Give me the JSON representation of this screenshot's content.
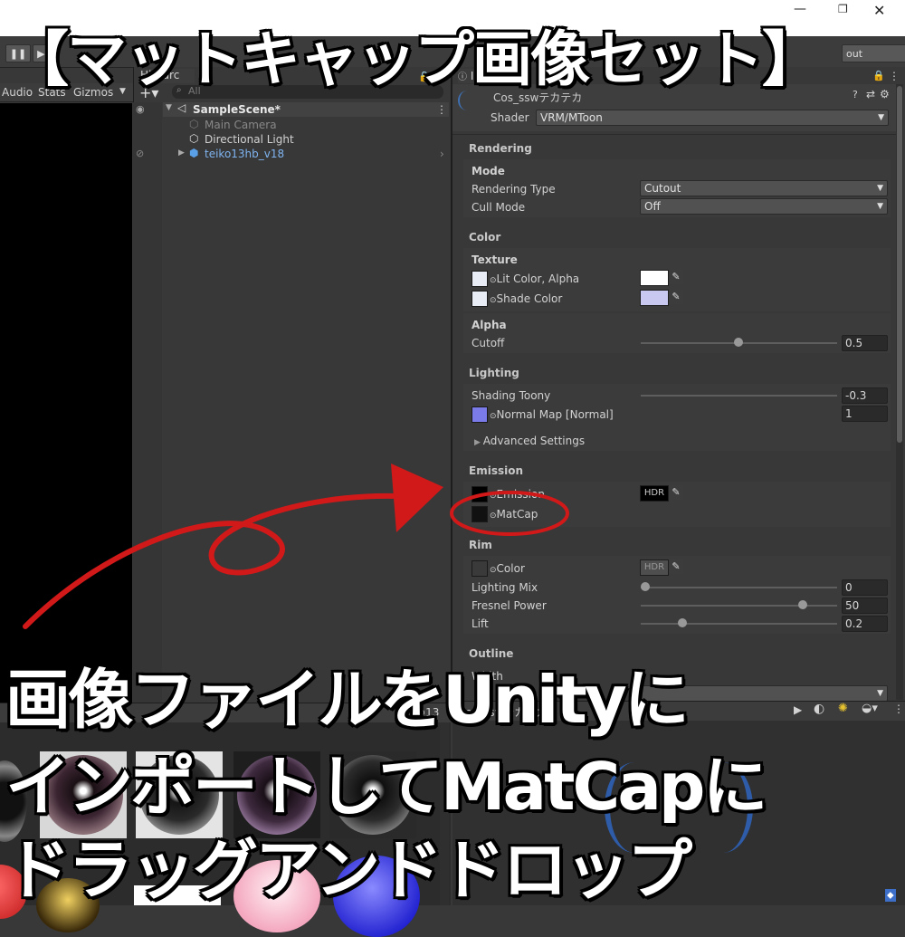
{
  "banner": "【マットキャップ画像セット】",
  "overlay": {
    "line1": "画像ファイルをUnityに",
    "line2": "インポートしてMatCapに",
    "line3": "ドラッグアンドドロップ"
  },
  "game_toolbar": {
    "audio": "Audio",
    "stats": "Stats",
    "gizmos": "Gizmos"
  },
  "top_toolbar": {
    "layout": "out"
  },
  "hierarchy": {
    "tab": "Hierarc",
    "search_placeholder": "All",
    "items": [
      {
        "label": "SampleScene*"
      },
      {
        "label": "Main Camera"
      },
      {
        "label": "Directional Light"
      },
      {
        "label": "teiko13hb_v18"
      }
    ]
  },
  "inspector": {
    "tab": "Ins",
    "material_name": "Cos_sswテカテカ",
    "shader_label": "Shader",
    "shader_value": "VRM/MToon",
    "sections": {
      "rendering": "Rendering",
      "mode": "Mode",
      "rendering_type_label": "Rendering Type",
      "rendering_type_value": "Cutout",
      "cull_mode_label": "Cull Mode",
      "cull_mode_value": "Off",
      "color": "Color",
      "texture": "Texture",
      "lit_color": "Lit Color, Alpha",
      "shade_color": "Shade Color",
      "alpha": "Alpha",
      "cutoff_label": "Cutoff",
      "cutoff_value": "0.5",
      "lighting": "Lighting",
      "shading_toony_label": "Shading Toony",
      "shading_toony_value": "-0.3",
      "normal_map_label": "Normal Map [Normal]",
      "normal_map_value": "1",
      "advanced": "Advanced Settings",
      "emission": "Emission",
      "emission_label": "Emission",
      "hdr": "HDR",
      "matcap_label": "MatCap",
      "rim": "Rim",
      "rim_color_label": "Color",
      "lighting_mix_label": "Lighting Mix",
      "lighting_mix_value": "0",
      "fresnel_label": "Fresnel Power",
      "fresnel_value": "50",
      "lift_label": "Lift",
      "lift_value": "0.2",
      "outline": "Outline",
      "width": "Width"
    },
    "preview_title": "Cos_sswテカテカ"
  },
  "project": {
    "count": "13"
  },
  "values": {
    "cutoff": 0.5,
    "shading_toony": -0.3,
    "lighting_mix": 0,
    "fresnel_fraction": 0.83,
    "lift": 0.2
  },
  "colors": {
    "annotation": "#d21919",
    "lit_color": "#ffffff",
    "shade_color": "#c8c8f0"
  }
}
